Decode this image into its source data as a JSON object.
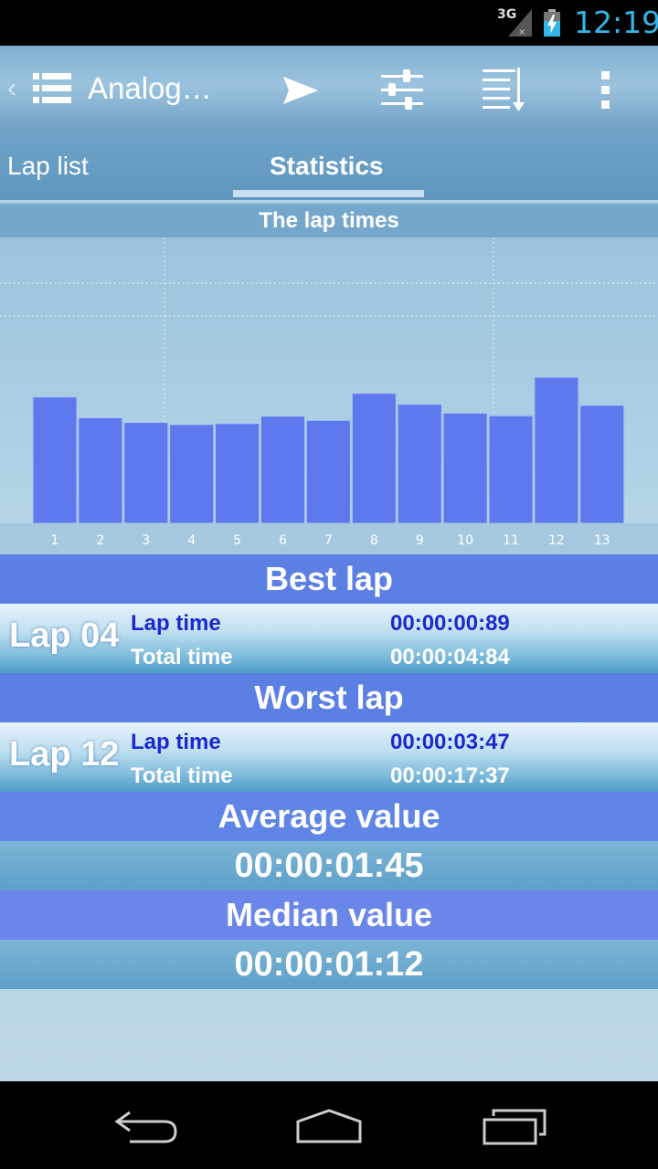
{
  "status_bar": {
    "network": "3G",
    "time": "12:19",
    "colors": {
      "time": "#33b5e5"
    }
  },
  "action_bar": {
    "title": "Analog…",
    "icons": [
      "app-list-icon",
      "send-icon",
      "sliders-icon",
      "sort-down-icon",
      "overflow-menu-icon"
    ]
  },
  "tabs": [
    {
      "label": "Lap list",
      "selected": false
    },
    {
      "label": "Statistics",
      "selected": true
    }
  ],
  "chart_data": {
    "type": "bar",
    "title": "The lap times",
    "categories": [
      "1",
      "2",
      "3",
      "4",
      "5",
      "6",
      "7",
      "8",
      "9",
      "10",
      "11",
      "12",
      "13"
    ],
    "values": [
      2.43,
      2.03,
      1.94,
      1.9,
      1.92,
      2.06,
      1.98,
      2.5,
      2.29,
      2.12,
      2.07,
      2.81,
      2.27
    ],
    "xlabel": "",
    "ylabel": "",
    "ylim": [
      0,
      5.5
    ],
    "grid": true,
    "colors": {
      "bar": "#5e78ed"
    }
  },
  "best_lap": {
    "header": "Best lap",
    "name": "Lap 04",
    "lap_time_label": "Lap time",
    "lap_time": "00:00:00:89",
    "total_time_label": "Total time",
    "total_time": "00:00:04:84"
  },
  "worst_lap": {
    "header": "Worst lap",
    "name": "Lap 12",
    "lap_time_label": "Lap time",
    "lap_time": "00:00:03:47",
    "total_time_label": "Total time",
    "total_time": "00:00:17:37"
  },
  "average": {
    "header": "Average value",
    "value": "00:00:01:45"
  },
  "median": {
    "header": "Median value",
    "value": "00:00:01:12"
  },
  "nav_bar": {
    "icons": [
      "back-icon",
      "home-icon",
      "recents-icon"
    ]
  }
}
